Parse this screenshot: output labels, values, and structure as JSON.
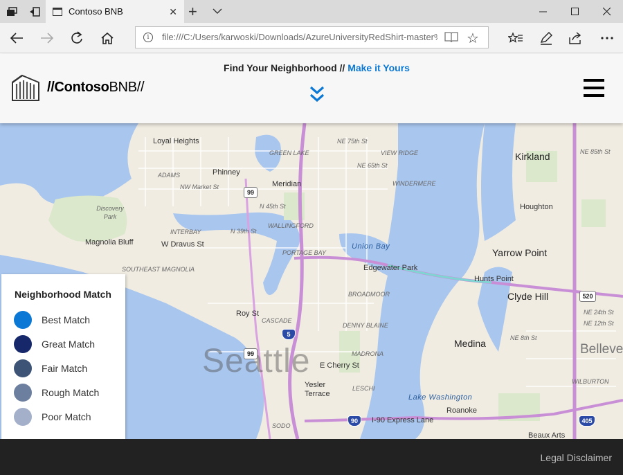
{
  "browser": {
    "tab_title": "Contoso BNB",
    "url": "file:///C:/Users/karwoski/Downloads/AzureUniversityRedShirt-master%",
    "tabbar_icons": [
      "tab-manager-icon",
      "set-aside-tabs-icon"
    ],
    "nav_icons": [
      "back-icon",
      "forward-icon",
      "refresh-icon",
      "home-icon"
    ],
    "toolbar_icons": [
      "favorites-hub-icon",
      "web-note-icon",
      "share-icon",
      "more-icon"
    ],
    "window_controls": [
      "minimize-icon",
      "maximize-icon",
      "close-icon"
    ]
  },
  "header": {
    "logo_prefix": "//Contoso",
    "logo_suffix": "BNB//",
    "tagline_main": "Find Your Neighborhood //",
    "tagline_accent": "Make it Yours",
    "accent_color": "#0a78d4"
  },
  "map": {
    "city_label": "Seattle",
    "places": {
      "loyal_heights": "Loyal Heights",
      "phinney": "Phinney",
      "green_lake": "GREEN LAKE",
      "view_ridge": "VIEW RIDGE",
      "ne_75th": "NE 75th St",
      "ne_65th": "NE 65th St",
      "windermere": "WINDERMERE",
      "adams": "ADAMS",
      "nw_market": "NW Market St",
      "meridian": "Meridian",
      "n_45th": "N 45th St",
      "discovery_park": "Discovery Park",
      "wallingford": "WALLINGFORD",
      "interbay": "INTERBAY",
      "n_39th": "N 39th St",
      "magnolia_bluff": "Magnolia Bluff",
      "w_dravus": "W Dravus St",
      "portage_bay": "PORTAGE BAY",
      "union_bay": "Union Bay",
      "edgewater_park": "Edgewater Park",
      "southeast_magnolia": "SOUTHEAST MAGNOLIA",
      "broadmoor": "BROADMOOR",
      "roy_st": "Roy St",
      "cascade": "CASCADE",
      "denny_blaine": "DENNY BLAINE",
      "madrona": "MADRONA",
      "e_cherry": "E Cherry St",
      "yesler_terrace": "Yesler Terrace",
      "leschi": "LESCHI",
      "lake_washington": "Lake Washington",
      "roanoke": "Roanoke",
      "i90_express": "I-90 Express Lane",
      "sodo": "SODO",
      "kirkland": "Kirkland",
      "houghton": "Houghton",
      "yarrow_point": "Yarrow Point",
      "hunts_point": "Hunts Point",
      "clyde_hill": "Clyde Hill",
      "medina": "Medina",
      "bellevue": "Belleve",
      "wilburton": "WILBURTON",
      "beaux_arts": "Beaux Arts",
      "ne_85th": "NE 85th St",
      "ne_8th": "NE 8th St",
      "ne_12th": "NE 12th St",
      "ne_24th": "NE 24th St"
    },
    "shields": {
      "sr99_north": "99",
      "sr99_south": "99",
      "i5": "5",
      "i90": "90",
      "sr520": "520",
      "i405": "405"
    }
  },
  "legend": {
    "title": "Neighborhood Match",
    "items": [
      {
        "label": "Best Match",
        "color": "#0a78d4"
      },
      {
        "label": "Great Match",
        "color": "#16286a"
      },
      {
        "label": "Fair Match",
        "color": "#3d5477"
      },
      {
        "label": "Rough Match",
        "color": "#6d7f9e"
      },
      {
        "label": "Poor Match",
        "color": "#a4b0c9"
      }
    ]
  },
  "footer": {
    "legal_link": "Legal Disclaimer"
  }
}
